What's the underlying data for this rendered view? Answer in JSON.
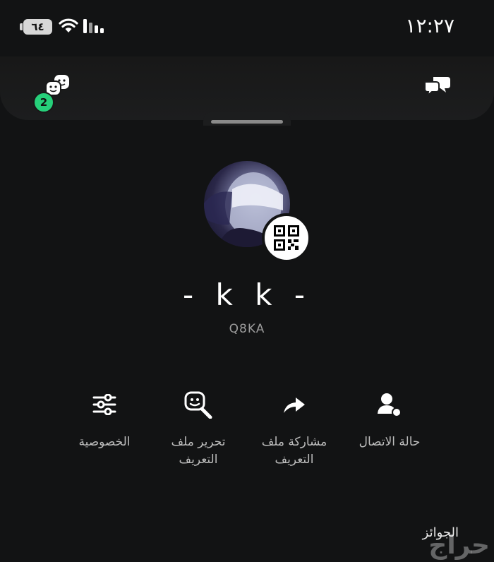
{
  "status_bar": {
    "time": "١٢:٢٧",
    "battery_level": "٦٤",
    "icons": [
      "battery-icon",
      "wifi-icon",
      "cellular-signal-icon"
    ]
  },
  "header": {
    "friends_badge_count": "2",
    "left_icon": "bitmoji-friends-icon",
    "right_icon": "chat-bubbles-icon"
  },
  "profile": {
    "display_name": "- k k -",
    "username": "Q8KA",
    "qr_icon": "qr-code-icon"
  },
  "actions": [
    {
      "label": "حالة الاتصال",
      "icon": "person-status-icon"
    },
    {
      "label": "مشاركة ملف\nالتعريف",
      "icon": "share-arrow-icon"
    },
    {
      "label": "تحرير ملف\nالتعريف",
      "icon": "edit-bitmoji-icon"
    },
    {
      "label": "الخصوصية",
      "icon": "sliders-icon"
    }
  ],
  "sections": {
    "awards_title": "الجوائز"
  },
  "watermark": "حراج",
  "colors": {
    "background": "#121314",
    "badge": "#26d07a",
    "label": "#bdbdbd"
  }
}
